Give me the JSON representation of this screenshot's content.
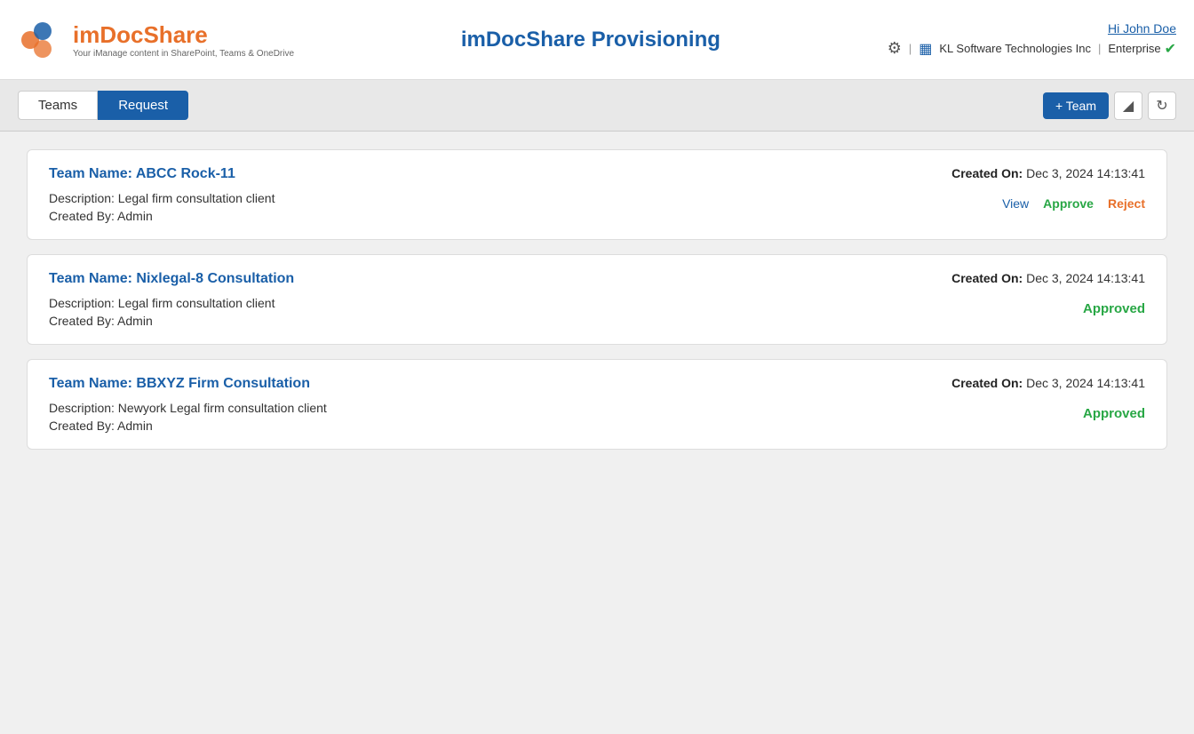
{
  "header": {
    "logo": {
      "title_part1": "im",
      "title_part2": "Doc",
      "title_part3": "Share",
      "subtitle": "Your iManage content in SharePoint, Teams & OneDrive"
    },
    "app_title": "imDocShare Provisioning",
    "user_greeting": "Hi John Doe",
    "company_name": "KL Software Technologies Inc",
    "plan": "Enterprise"
  },
  "tabs": {
    "teams_label": "Teams",
    "request_label": "Request",
    "active": "Request"
  },
  "toolbar": {
    "add_team_label": "+ Team",
    "filter_icon": "filter",
    "refresh_icon": "refresh"
  },
  "teams": [
    {
      "id": 1,
      "name": "Team Name: ABCC Rock-11",
      "description": "Description: Legal firm consultation client",
      "created_by": "Created By: Admin",
      "created_on_label": "Created On:",
      "created_on_value": "Dec 3, 2024 14:13:41",
      "status": "pending",
      "actions": {
        "view": "View",
        "approve": "Approve",
        "reject": "Reject"
      }
    },
    {
      "id": 2,
      "name": "Team Name: Nixlegal-8 Consultation",
      "description": "Description: Legal firm consultation client",
      "created_by": "Created By: Admin",
      "created_on_label": "Created On:",
      "created_on_value": "Dec 3, 2024 14:13:41",
      "status": "approved",
      "status_label": "Approved"
    },
    {
      "id": 3,
      "name": "Team Name: BBXYZ Firm Consultation",
      "description": "Description: Newyork Legal firm consultation client",
      "created_by": "Created By: Admin",
      "created_on_label": "Created On:",
      "created_on_value": "Dec 3, 2024 14:13:41",
      "status": "approved",
      "status_label": "Approved"
    }
  ]
}
